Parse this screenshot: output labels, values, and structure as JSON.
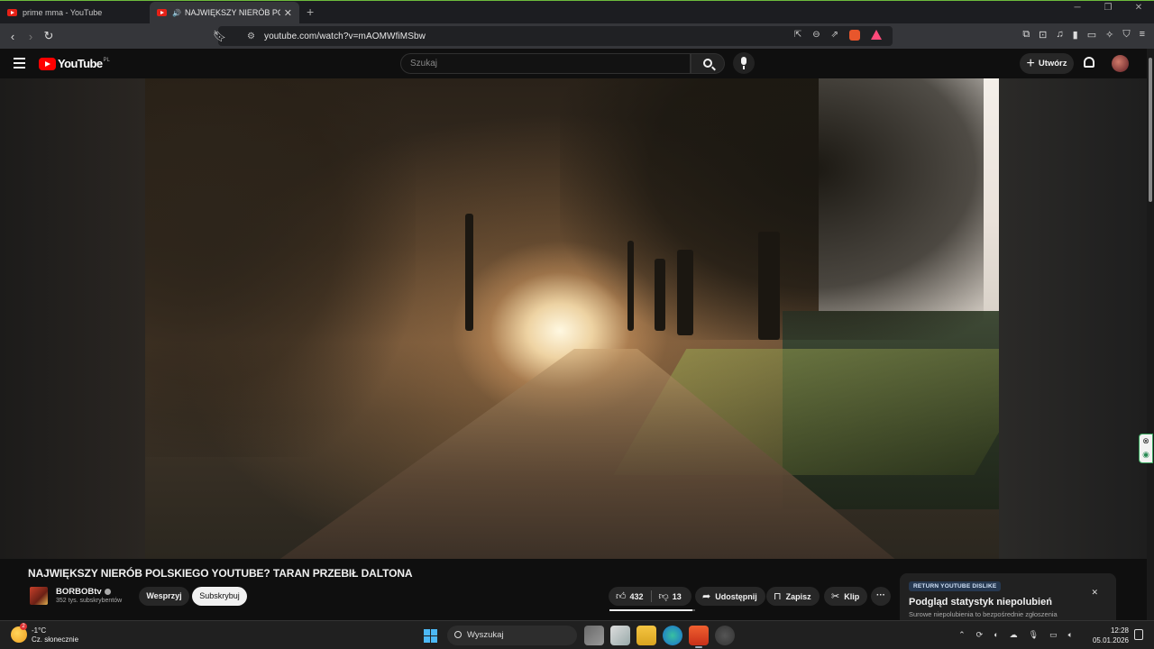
{
  "browser": {
    "tabs": [
      {
        "label": "prime mma - YouTube",
        "active": false
      },
      {
        "label": "NAJWIĘKSZY NIERÓB POLSKIEGO YOUTUBE? TARAN PRZEBIŁ DALTONA - YouTube",
        "active": true,
        "playing_audio": true
      }
    ],
    "url": "youtube.com/watch?v=mAOMWfiMSbw"
  },
  "youtube": {
    "logo": "YouTube",
    "country": "PL",
    "search_placeholder": "Szukaj",
    "create_label": "Utwórz"
  },
  "video": {
    "title": "NAJWIĘKSZY NIERÓB POLSKIEGO YOUTUBE? TARAN PRZEBIŁ DALTONA",
    "channel": "BORBOBtv",
    "subscribers": "352 tys. subskrybentów",
    "join_label": "Wesprzyj",
    "subscribe_label": "Subskrybuj",
    "likes": "432",
    "dislikes": "13",
    "like_ratio": 0.97,
    "share_label": "Udostępnij",
    "save_label": "Zapisz",
    "clip_label": "Klip"
  },
  "ryd_popup": {
    "badge": "RETURN YOUTUBE DISLIKE",
    "heading": "Podgląd statystyk niepolubień",
    "subtext": "Surowe niepolubienia to bezpośrednie zgłoszenia"
  },
  "taskbar": {
    "temperature": "-1°C",
    "weather": "Cz. słonecznie",
    "weather_badge": "2",
    "search_label": "Wyszukaj",
    "time": "12:28",
    "date": "05.01.2026"
  },
  "colors": {
    "accent": "#ff0000",
    "brave": "#e8562c",
    "frame": "#6dbb3c"
  }
}
